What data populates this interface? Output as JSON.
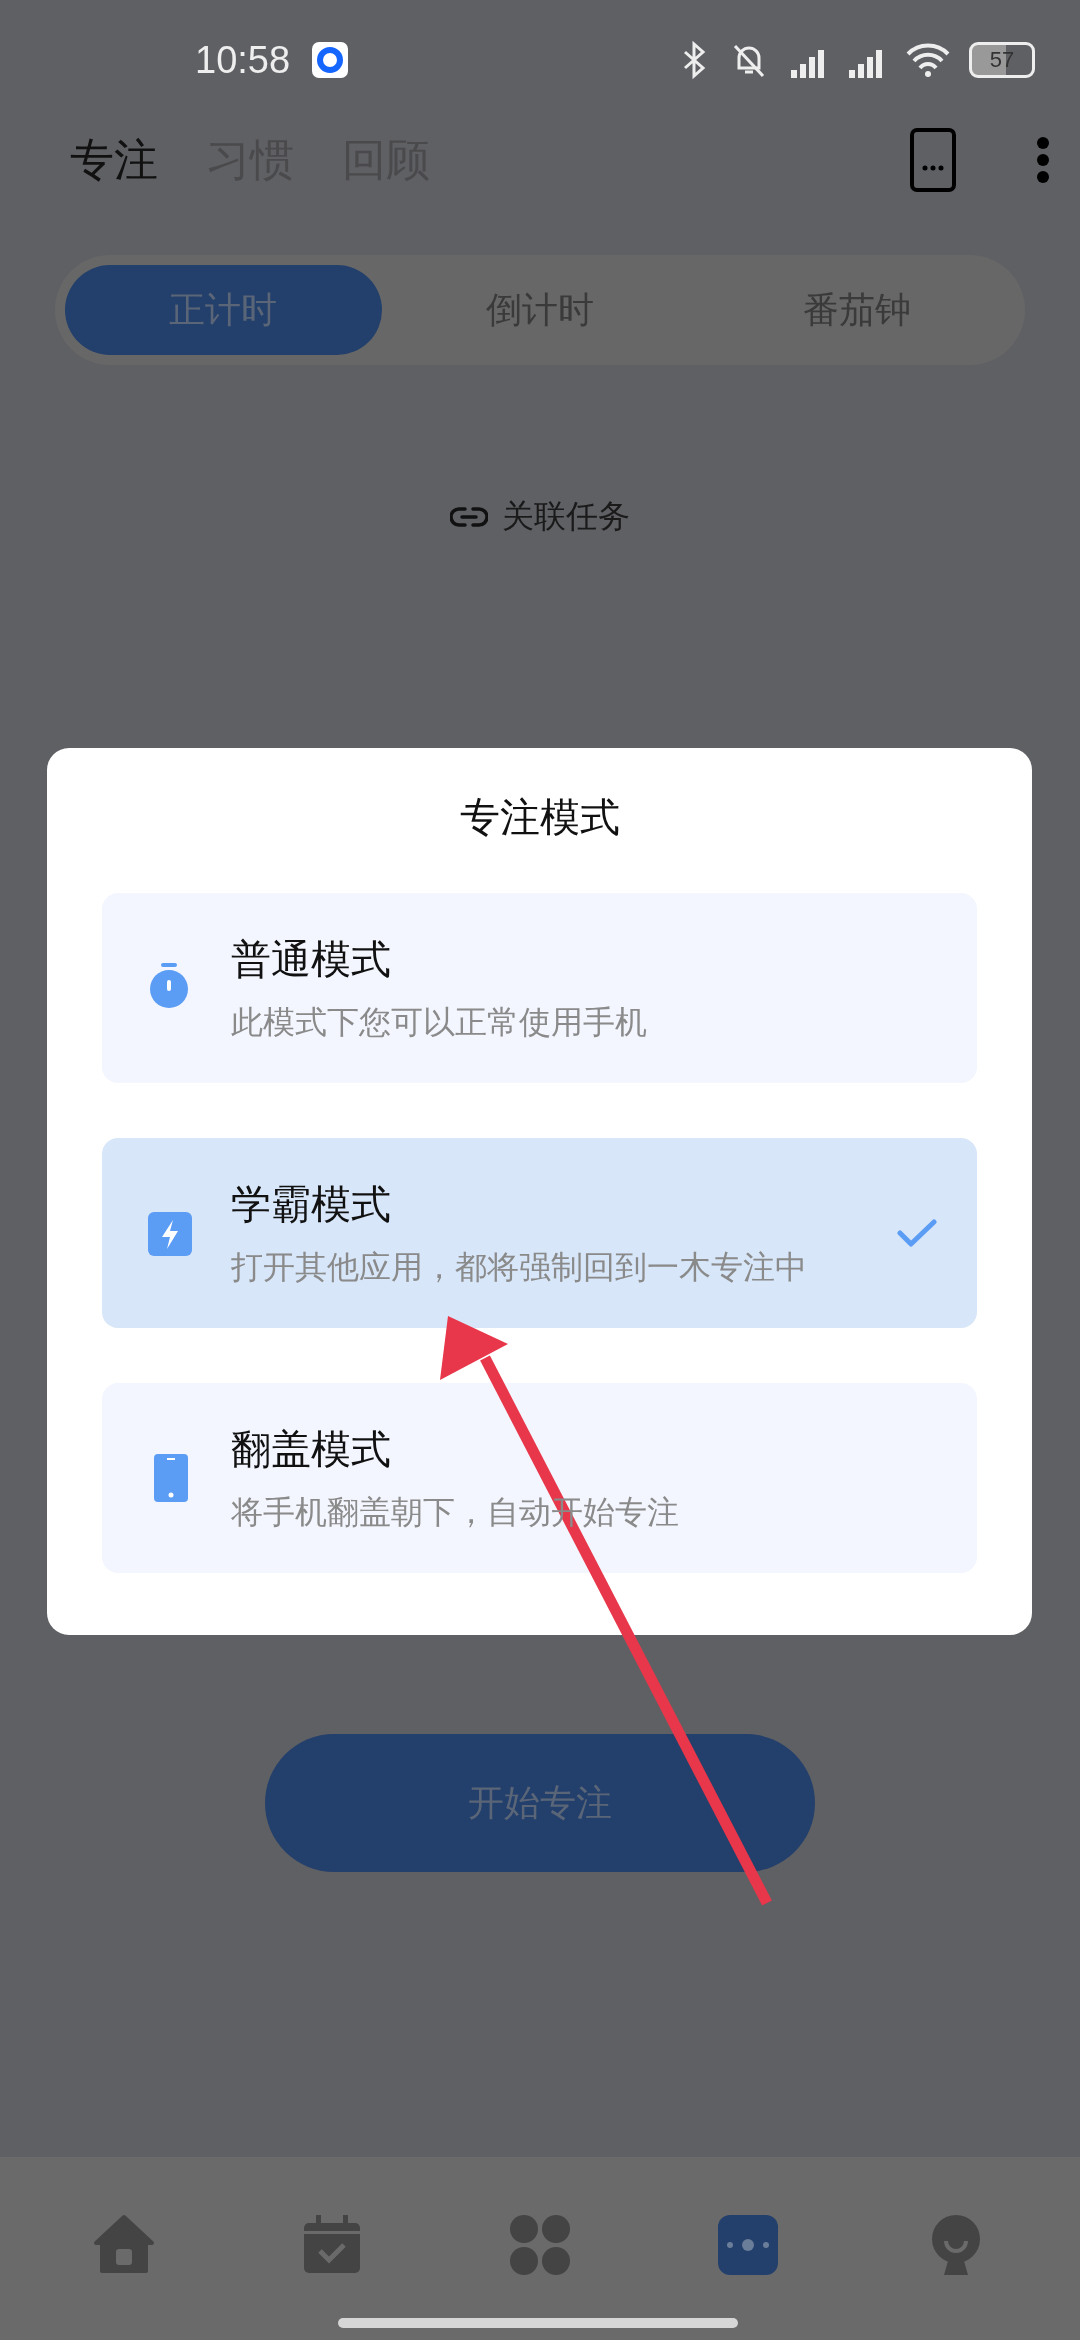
{
  "status_bar": {
    "time": "10:58",
    "battery": "57"
  },
  "nav_tabs": [
    {
      "label": "专注",
      "selected": true
    },
    {
      "label": "习惯",
      "selected": false
    },
    {
      "label": "回顾",
      "selected": false
    }
  ],
  "timer_modes": [
    {
      "label": "正计时",
      "selected": true
    },
    {
      "label": "倒计时",
      "selected": false
    },
    {
      "label": "番茄钟",
      "selected": false
    }
  ],
  "link_task": "关联任务",
  "dialog": {
    "title": "专注模式",
    "options": [
      {
        "kind": "timer",
        "title": "普通模式",
        "subtitle": "此模式下您可以正常使用手机",
        "selected": false
      },
      {
        "kind": "bolt",
        "title": "学霸模式",
        "subtitle": "打开其他应用，都将强制回到一木专注中",
        "selected": true
      },
      {
        "kind": "phone",
        "title": "翻盖模式",
        "subtitle": "将手机翻盖朝下，自动开始专注",
        "selected": false
      }
    ]
  },
  "start_button": "开始专注",
  "bottom_nav": [
    {
      "kind": "home",
      "selected": false
    },
    {
      "kind": "calendar",
      "selected": false
    },
    {
      "kind": "apps",
      "selected": false
    },
    {
      "kind": "focus",
      "selected": true
    },
    {
      "kind": "profile",
      "selected": false
    }
  ],
  "annotations": [
    {
      "kind": "arrow"
    }
  ]
}
